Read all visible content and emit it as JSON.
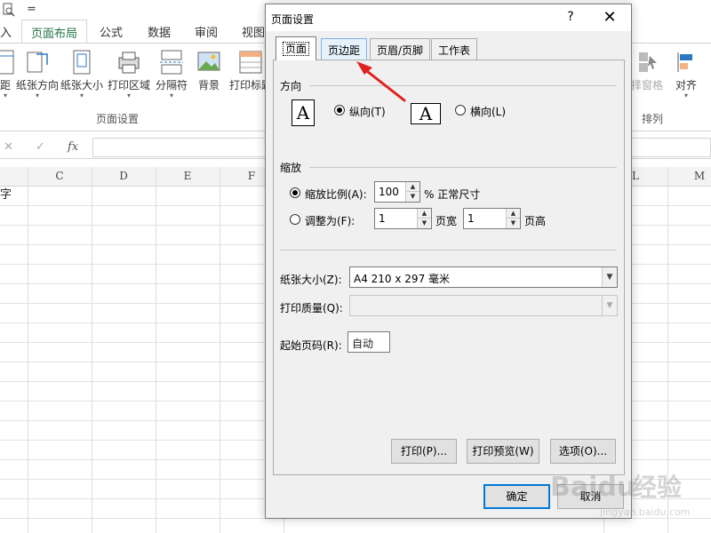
{
  "qat": {
    "save_icon": "search-doc-icon",
    "more": "="
  },
  "ribbon_tabs": [
    {
      "label": "入"
    },
    {
      "label": "页面布局"
    },
    {
      "label": "公式"
    },
    {
      "label": "数据"
    },
    {
      "label": "审阅"
    },
    {
      "label": "视图"
    }
  ],
  "ribbon_buttons": [
    {
      "label": "距",
      "icon": "margins-icon"
    },
    {
      "label": "纸张方向",
      "icon": "orientation-icon"
    },
    {
      "label": "纸张大小",
      "icon": "size-icon"
    },
    {
      "label": "打印区域",
      "icon": "print-area-icon"
    },
    {
      "label": "分隔符",
      "icon": "breaks-icon"
    },
    {
      "label": "背景",
      "icon": "background-icon"
    },
    {
      "label": "打印标题",
      "icon": "print-titles-icon"
    }
  ],
  "ribbon_right": [
    {
      "label": "择窗格",
      "icon": "selection-pane-icon"
    },
    {
      "label": "对齐",
      "icon": "align-icon"
    }
  ],
  "ribbon_groups": {
    "page_setup": "页面设置",
    "arrange": "排列"
  },
  "formula_bar": {
    "cancel": "✕",
    "enter": "✓",
    "fx": "fx"
  },
  "columns": [
    "C",
    "D",
    "E",
    "F",
    "L",
    "M"
  ],
  "cell_text": "字",
  "dialog": {
    "title": "页面设置",
    "help": "?",
    "close": "✕",
    "tabs": [
      "页面",
      "页边距",
      "页眉/页脚",
      "工作表"
    ],
    "orientation": {
      "label": "方向",
      "portrait": "纵向(T)",
      "landscape": "横向(L)",
      "selected": "portrait",
      "glyph": "A"
    },
    "scaling": {
      "label": "缩放",
      "adjust_label": "缩放比例(A):",
      "adjust_value": "100",
      "adjust_suffix": "% 正常尺寸",
      "fit_label": "调整为(F):",
      "fit_wide": "1",
      "fit_wide_label": "页宽",
      "fit_tall": "1",
      "fit_tall_label": "页高",
      "selected": "adjust"
    },
    "paper_size": {
      "label": "纸张大小(Z):",
      "value": "A4 210 x 297 毫米"
    },
    "print_quality": {
      "label": "打印质量(Q):",
      "value": ""
    },
    "first_page": {
      "label": "起始页码(R):",
      "value": "自动"
    },
    "buttons": {
      "print": "打印(P)...",
      "preview": "打印预览(W)",
      "options": "选项(O)..."
    },
    "ok": "确定",
    "cancel": "取消"
  },
  "annotation_color": "#e02020",
  "watermark": {
    "brand": "Baidu",
    "text": "经验",
    "url": "jingyan.baidu.com"
  }
}
